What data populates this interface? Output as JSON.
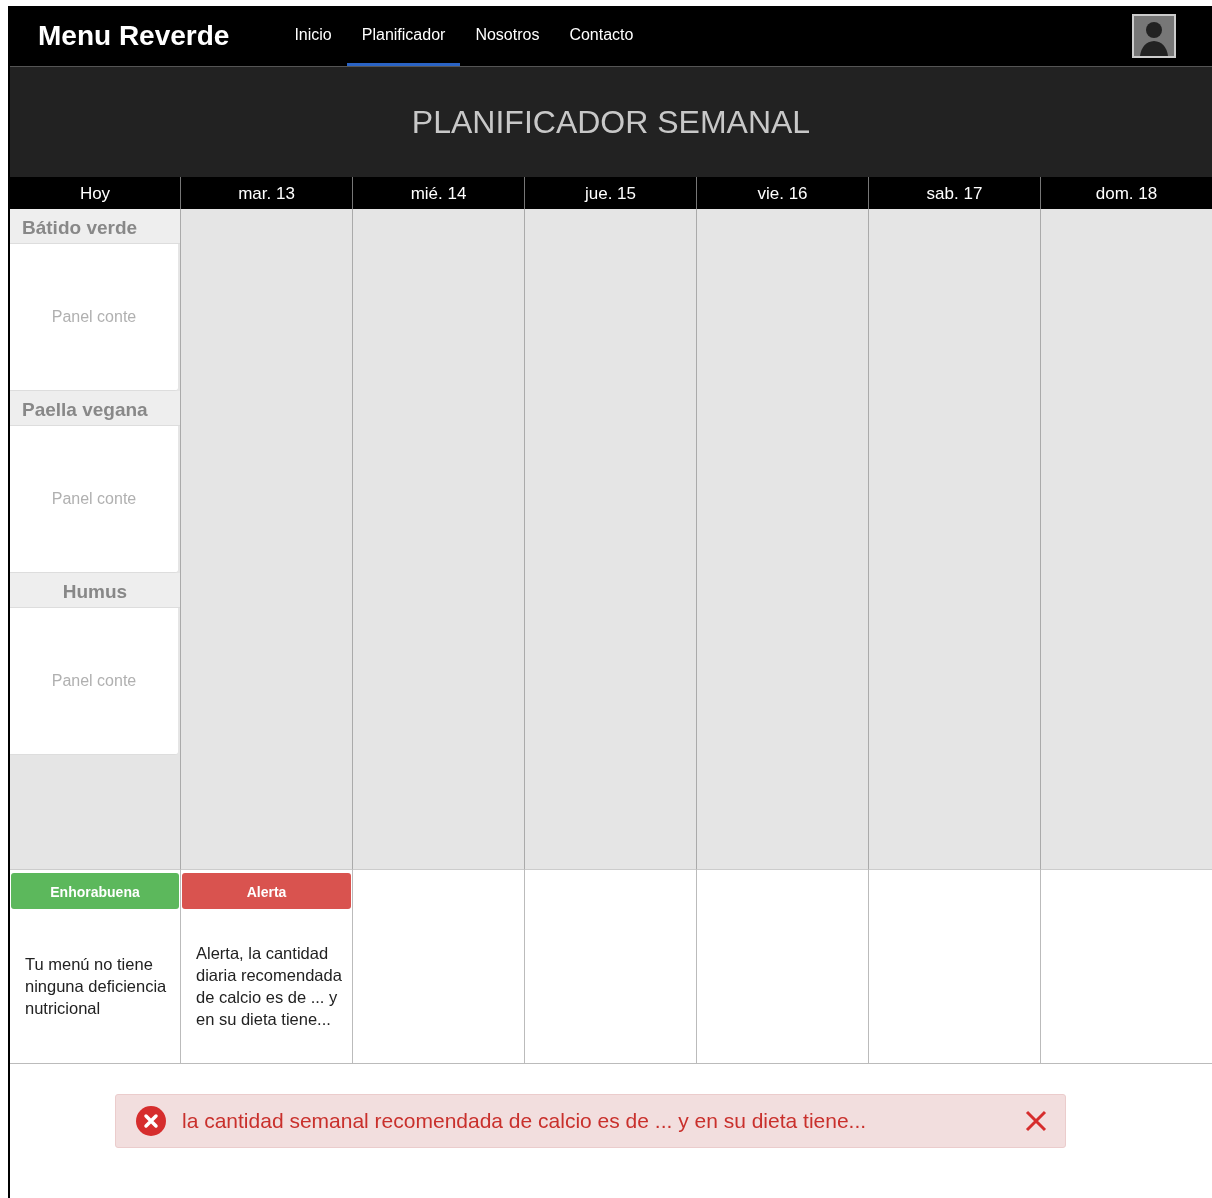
{
  "navbar": {
    "brand": "Menu Reverde",
    "links": [
      {
        "label": "Inicio",
        "selected": false
      },
      {
        "label": "Planificador",
        "selected": true
      },
      {
        "label": "Nosotros",
        "selected": false
      },
      {
        "label": "Contacto",
        "selected": false
      }
    ]
  },
  "title": "PLANIFICADOR SEMANAL",
  "days": [
    "Hoy",
    "mar. 13",
    "mié. 14",
    "jue. 15",
    "vie. 16",
    "sab. 17",
    "dom. 18"
  ],
  "meals": [
    {
      "name": "Bátido verde",
      "content": "Panel conte"
    },
    {
      "name": "Paella vegana",
      "content": "Panel conte"
    },
    {
      "name": "Humus",
      "content": "Panel conte"
    }
  ],
  "notices": [
    {
      "kind": "success",
      "title": "Enhorabuena",
      "text": "Tu menú no tiene ninguna deficiencia nutricional"
    },
    {
      "kind": "danger",
      "title": "Alerta",
      "text": "Alerta, la cantidad diaria recomendada de calcio es de ... y en su dieta tiene..."
    }
  ],
  "alert": {
    "text": "la cantidad semanal recomendada de calcio es de ... y en su dieta tiene..."
  }
}
